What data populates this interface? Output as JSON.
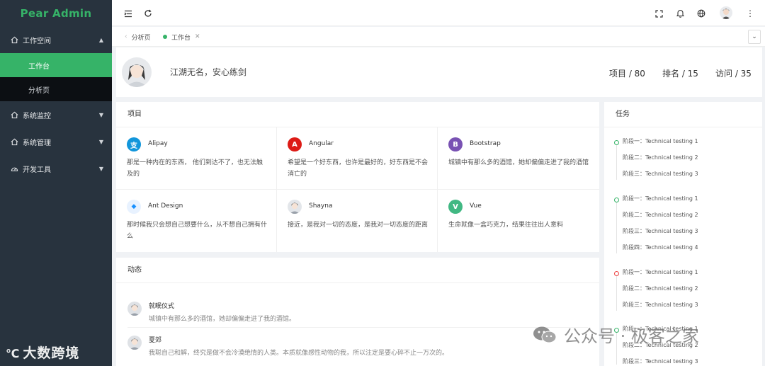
{
  "app": {
    "title": "Pear Admin"
  },
  "sidebar": {
    "groups": [
      {
        "label": "工作空间",
        "icon": "home-icon",
        "expanded": true,
        "items": [
          {
            "label": "工作台",
            "active": true
          },
          {
            "label": "分析页",
            "active": false
          }
        ]
      },
      {
        "label": "系统监控",
        "icon": "home-icon",
        "expanded": false
      },
      {
        "label": "系统管理",
        "icon": "home-icon",
        "expanded": false
      },
      {
        "label": "开发工具",
        "icon": "dashboard-icon",
        "expanded": false
      }
    ]
  },
  "header": {
    "icons": [
      "menu-fold-icon",
      "refresh-icon",
      "fullscreen-icon",
      "bell-icon",
      "globe-icon",
      "user-avatar",
      "more-vertical-icon"
    ]
  },
  "tabs": {
    "items": [
      {
        "label": "分析页",
        "active": false
      },
      {
        "label": "工作台",
        "active": true
      }
    ]
  },
  "profile": {
    "motto": "江湖无名，安心练剑",
    "stats": {
      "projects": "项目 / 80",
      "rank": "排名 / 15",
      "visits": "访问 / 35"
    }
  },
  "projects": {
    "title": "项目",
    "items": [
      {
        "name": "Alipay",
        "desc": "那是一种内在的东西， 他们到达不了，也无法触及的",
        "icon": "alipay-icon",
        "color": "#1296db",
        "glyph": "支"
      },
      {
        "name": "Angular",
        "desc": "希望是一个好东西，也许是最好的，好东西是不会消亡的",
        "icon": "angular-icon",
        "color": "#dd1b16",
        "glyph": "A"
      },
      {
        "name": "Bootstrap",
        "desc": "城镇中有那么多的酒馆，她却偏偏走进了我的酒馆",
        "icon": "bootstrap-icon",
        "color": "#7952b3",
        "glyph": "B"
      },
      {
        "name": "Ant Design",
        "desc": "那时候我只会想自己想要什么，从不想自己拥有什么",
        "icon": "ant-design-icon",
        "color": "#1890ff",
        "glyph": "◆"
      },
      {
        "name": "Shayna",
        "desc": "接近，是我对一切的态度，是我对一切态度的距离",
        "icon": "avatar-icon",
        "color": "#cfd3d8",
        "glyph": ""
      },
      {
        "name": "Vue",
        "desc": "生命就像一盒巧克力，结果往往出人意料",
        "icon": "vue-icon",
        "color": "#41b883",
        "glyph": "V"
      }
    ]
  },
  "activity": {
    "title": "动态",
    "items": [
      {
        "name": "就眠仪式",
        "desc": "城镇中有那么多的酒馆，她却偏偏走进了我的酒馆。"
      },
      {
        "name": "夏郊",
        "desc": "我聪自己和解，终究是做不会冷漠绝情的人类。本质就像感性动物的我，所以注定是要心碎不止一万次的。"
      }
    ]
  },
  "tasks": {
    "title": "任务",
    "groups": [
      {
        "status": "green",
        "items": [
          "阶段一：Technical testing 1",
          "阶段二：Technical testing 2",
          "阶段三：Technical testing 3"
        ]
      },
      {
        "status": "green",
        "items": [
          "阶段一：Technical testing 1",
          "阶段二：Technical testing 2",
          "阶段三：Technical testing 3",
          "阶段四：Technical testing 4"
        ]
      },
      {
        "status": "red",
        "items": [
          "阶段一：Technical testing 1",
          "阶段二：Technical testing 2",
          "阶段三：Technical testing 3"
        ]
      },
      {
        "status": "green",
        "items": [
          "阶段一：Technical testing 1",
          "阶段二：Technical testing 2",
          "阶段三：Technical testing 3"
        ]
      }
    ]
  },
  "watermarks": {
    "left": "大数跨境",
    "right": "公众号 · 极客之家"
  },
  "colors": {
    "accent": "#36b368",
    "sidebar": "#28333e",
    "submenu": "#0c0f13"
  }
}
